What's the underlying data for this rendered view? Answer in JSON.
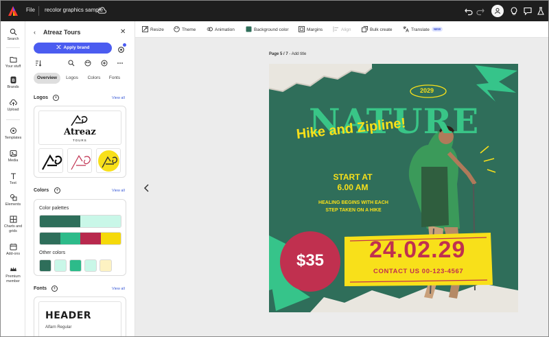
{
  "app": {
    "menu_file": "File",
    "document_title": "recolor graphics sample"
  },
  "rail": {
    "items": [
      {
        "label": "Search",
        "icon": "search-icon"
      },
      {
        "label": "Your stuff",
        "icon": "folder-icon"
      },
      {
        "label": "Brands",
        "icon": "brand-icon"
      },
      {
        "label": "Upload",
        "icon": "upload-icon"
      },
      {
        "label": "Templates",
        "icon": "templates-icon"
      },
      {
        "label": "Media",
        "icon": "media-icon"
      },
      {
        "label": "Text",
        "icon": "text-icon"
      },
      {
        "label": "Elements",
        "icon": "elements-icon"
      },
      {
        "label": "Charts and grids",
        "icon": "chart-icon"
      },
      {
        "label": "Add-ons",
        "icon": "addons-icon"
      },
      {
        "label": "Premium member",
        "icon": "crown-icon"
      }
    ]
  },
  "panel": {
    "title": "Atreaz Tours",
    "apply_label": "Apply brand",
    "tabs": [
      "Overview",
      "Logos",
      "Colors",
      "Fonts"
    ],
    "logos": {
      "title": "Logos",
      "view_all": "View all",
      "brand_name": "Atreaz",
      "brand_tagline": "TOURS"
    },
    "colors": {
      "title": "Colors",
      "view_all": "View all",
      "palettes_label": "Color palettes",
      "palette1": [
        "#2e6e5a",
        "#c9f7e8"
      ],
      "palette2": [
        "#2e6e5a",
        "#2dbb8a",
        "#b8294d",
        "#f5d90a"
      ],
      "other_label": "Other colors",
      "other": [
        "#2e6e5a",
        "#c9f7e8",
        "#2dbb8a",
        "#c9f7e8",
        "#fdf2c2"
      ]
    },
    "fonts": {
      "title": "Fonts",
      "view_all": "View all",
      "header_sample": "HEADER",
      "font_name": "Alfarn Regular"
    }
  },
  "toolbar": {
    "resize": "Resize",
    "theme": "Theme",
    "animation": "Animation",
    "background_color": "Background color",
    "margins": "Margins",
    "align": "Align",
    "bulk_create": "Bulk create",
    "translate": "Translate",
    "new_badge": "NEW"
  },
  "canvas": {
    "page_label": "Page 5 / 7",
    "add_title": " - Add title"
  },
  "poster": {
    "year": "2029",
    "headline": "NATURE",
    "subhead": "Hike and Zipline!",
    "start_line1": "START AT",
    "start_line2": "6.00 AM",
    "tagline_line1": "HEALING BEGINS WITH EACH",
    "tagline_line2": "STEP TAKEN ON A HIKE",
    "price": "$35",
    "date": "24.02.29",
    "contact": "CONTACT US 00-123-4567",
    "colors": {
      "bg": "#2f6e5a",
      "accent_green": "#36c48a",
      "yellow": "#f8e01a",
      "crimson": "#c0304f",
      "headline": "#39c587"
    }
  }
}
